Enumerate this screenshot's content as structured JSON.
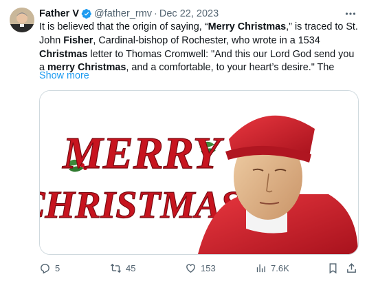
{
  "tweet": {
    "author": {
      "name": "Father V",
      "handle": "@father_rmv",
      "verified": true
    },
    "separator": "·",
    "date": "Dec 22, 2023",
    "body": {
      "t1": "It is believed that the origin of saying, “",
      "b1": "Merry Christmas",
      "t2": ",” is traced to St. John ",
      "b2": "Fisher",
      "t3": ", Cardinal-bishop of Rochester, who wrote in a 1534 ",
      "b3": "Christmas",
      "t4": " letter to Thomas Cromwell: \"And this our Lord God send you a ",
      "b4": "merry Christmas",
      "t5": ", and a comfortable, to your heart’s desire.\" The"
    },
    "show_more": "Show more",
    "image": {
      "lettering_top": "MERRY",
      "lettering_bottom": "CHRISTMAS"
    },
    "stats": {
      "replies": "5",
      "reposts": "45",
      "likes": "153",
      "views": "7.6K"
    },
    "colors": {
      "accent": "#1d9bf0",
      "muted": "#536471",
      "text": "#0f1419",
      "border": "#cfd9de"
    },
    "icons": [
      "verified-badge-icon",
      "more-dots-icon",
      "reply-icon",
      "repost-icon",
      "like-icon",
      "views-icon",
      "bookmark-icon",
      "share-icon"
    ]
  }
}
